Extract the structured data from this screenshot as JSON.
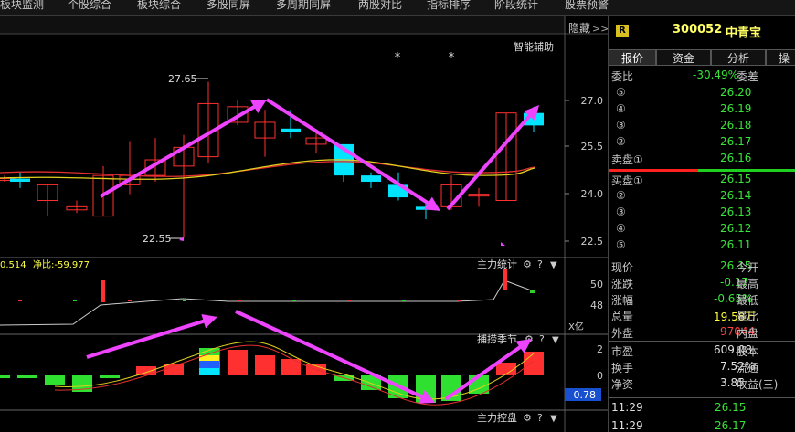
{
  "top_tabs": [
    "板块监测",
    "个股综合",
    "板块综合",
    "多股同屏",
    "多周期同屏",
    "两股对比",
    "指标排序",
    "阶段统计",
    "股票预警"
  ],
  "hide_label": "隐藏",
  "hide_arrows": ">>",
  "smart_assist": "智能辅助",
  "stock": {
    "badge": "R",
    "code": "300052",
    "name": "中青宝"
  },
  "sub_tabs": [
    "报价",
    "资金",
    "分析",
    "操"
  ],
  "quote": {
    "wei_bi_label": "委比",
    "wei_bi_value": "-30.49%",
    "wei_cha_label": "委差",
    "sell": [
      {
        "label": "⑤",
        "price": "26.20"
      },
      {
        "label": "④",
        "price": "26.19"
      },
      {
        "label": "③",
        "price": "26.18"
      },
      {
        "label": "②",
        "price": "26.17"
      },
      {
        "label": "卖盘①",
        "price": "26.16"
      }
    ],
    "buy": [
      {
        "label": "买盘①",
        "price": "26.15"
      },
      {
        "label": "②",
        "price": "26.14"
      },
      {
        "label": "③",
        "price": "26.13"
      },
      {
        "label": "④",
        "price": "26.12"
      },
      {
        "label": "⑤",
        "price": "26.11"
      }
    ],
    "stats": [
      {
        "l1": "现价",
        "v": "26.15",
        "vc": "green",
        "l2": "今开"
      },
      {
        "l1": "涨跌",
        "v": "-0.17",
        "vc": "green",
        "l2": "最高"
      },
      {
        "l1": "涨幅",
        "v": "-0.65%",
        "vc": "green",
        "l2": "最低"
      },
      {
        "l1": "总量",
        "v": "19.58万",
        "vc": "yellow",
        "l2": "量比"
      },
      {
        "l1": "外盘",
        "v": "97044",
        "vc": "red",
        "l2": "内盘"
      },
      {
        "l1": "市盈",
        "v": "609.08",
        "vc": "white",
        "l2": "股本"
      },
      {
        "l1": "换手",
        "v": "7.52%",
        "vc": "white",
        "l2": "流通"
      },
      {
        "l1": "净资",
        "v": "3.85",
        "vc": "white",
        "l2": "收益(三)"
      }
    ],
    "ticks": [
      {
        "time": "11:29",
        "price": "26.15"
      },
      {
        "time": "11:29",
        "price": "26.17"
      }
    ]
  },
  "main_chart": {
    "y_ticks": [
      "27.0",
      "25.5",
      "24.0",
      "22.5"
    ],
    "high_label": "27.65",
    "low_label": "22.55",
    "star": "*"
  },
  "fund_panel": {
    "left_text1": "0.514",
    "left_text2": "净比:-59.977",
    "title": "主力统计",
    "y_ticks": [
      "50",
      "48"
    ],
    "unit": "X亿"
  },
  "season_panel": {
    "title": "捕捞季节",
    "y_ticks": [
      "2",
      "0"
    ],
    "value_box": "0.78"
  },
  "control_panel": {
    "title": "主力控盘"
  },
  "colors": {
    "up": "#ff3030",
    "down": "#00e5ff",
    "arrow": "#ee44ff",
    "ma_yellow": "#e0d020",
    "ma_red": "#e03030"
  }
}
